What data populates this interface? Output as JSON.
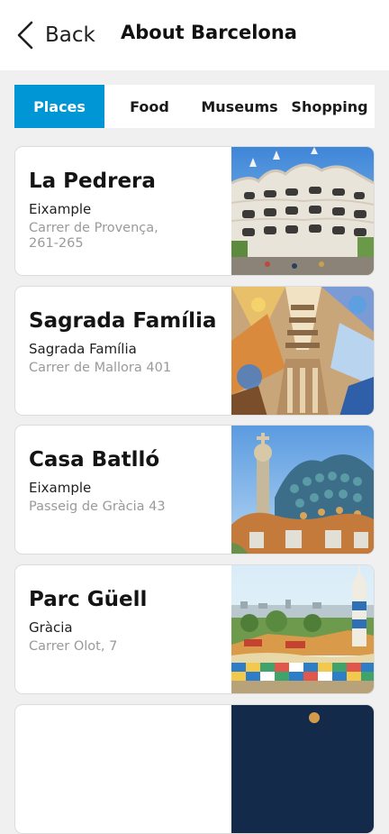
{
  "header": {
    "back_label": "Back",
    "title": "About Barcelona"
  },
  "tabs": [
    {
      "label": "Places",
      "active": true
    },
    {
      "label": "Food",
      "active": false
    },
    {
      "label": "Museums",
      "active": false
    },
    {
      "label": "Shopping",
      "active": false
    }
  ],
  "places": [
    {
      "name": "La Pedrera",
      "district": "Eixample",
      "address": "Carrer de Provença, 261-265",
      "image": "la-pedrera-photo"
    },
    {
      "name": "Sagrada Família",
      "district": "Sagrada Família",
      "address": "Carrer de Mallora 401",
      "image": "sagrada-familia-photo"
    },
    {
      "name": "Casa Batlló",
      "district": "Eixample",
      "address": "Passeig de Gràcia 43",
      "image": "casa-batllo-photo"
    },
    {
      "name": "Parc Güell",
      "district": "Gràcia",
      "address": "Carrer Olot, 7",
      "image": "parc-guell-photo"
    }
  ],
  "colors": {
    "accent": "#0096d6",
    "background": "#f0f0f0",
    "address_text": "#9a9a9a"
  },
  "icons": {
    "back": "chevron-left-icon"
  }
}
